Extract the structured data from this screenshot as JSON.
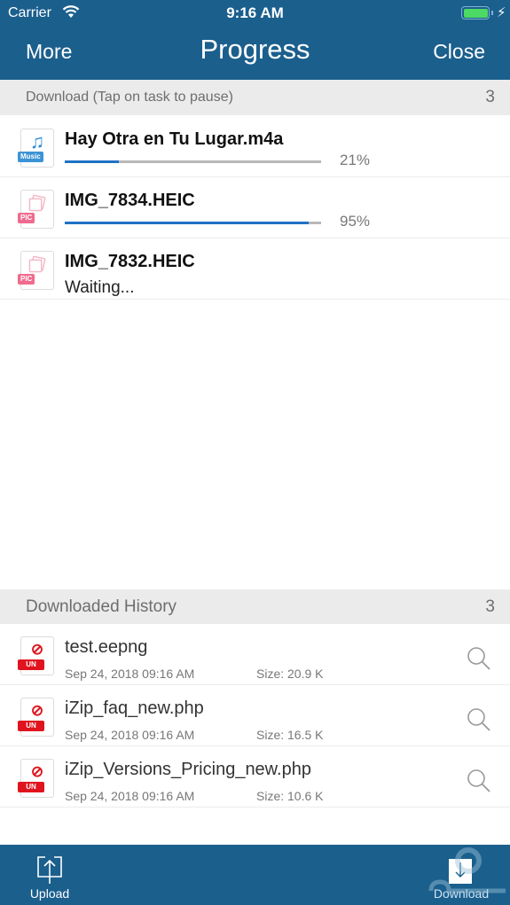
{
  "status_bar": {
    "carrier": "Carrier",
    "time": "9:16 AM",
    "battery_level": 1.0,
    "charging": true
  },
  "nav": {
    "left_label": "More",
    "title": "Progress",
    "right_label": "Close"
  },
  "download_section": {
    "label": "Download (Tap on task to pause)",
    "count": "3",
    "items": [
      {
        "name": "Hay Otra en Tu Lugar.m4a",
        "type_badge": "Music",
        "icon": "music-note-icon",
        "progress": 0.21,
        "progress_label": "21%"
      },
      {
        "name": "IMG_7834.HEIC",
        "type_badge": "PIC",
        "icon": "picture-icon",
        "progress": 0.95,
        "progress_label": "95%"
      },
      {
        "name": "IMG_7832.HEIC",
        "type_badge": "PIC",
        "icon": "picture-icon",
        "status": "Waiting..."
      }
    ]
  },
  "history_section": {
    "label": "Downloaded History",
    "count": "3",
    "items": [
      {
        "name": "test.eepng",
        "type_badge": "UN",
        "date": "Sep 24, 2018 09:16 AM",
        "size": "Size: 20.9 K"
      },
      {
        "name": "iZip_faq_new.php",
        "type_badge": "UN",
        "date": "Sep 24, 2018 09:16 AM",
        "size": "Size: 16.5 K"
      },
      {
        "name": "iZip_Versions_Pricing_new.php",
        "type_badge": "UN",
        "date": "Sep 24, 2018 09:16 AM",
        "size": "Size: 10.6 K"
      }
    ]
  },
  "toolbar": {
    "upload_label": "Upload",
    "download_label": "Download"
  },
  "colors": {
    "brand_blue": "#1b5f8d",
    "progress_blue": "#1f72c4",
    "music_badge": "#3b93d6",
    "pic_badge": "#f06b8d",
    "unknown_badge": "#e0141e"
  }
}
